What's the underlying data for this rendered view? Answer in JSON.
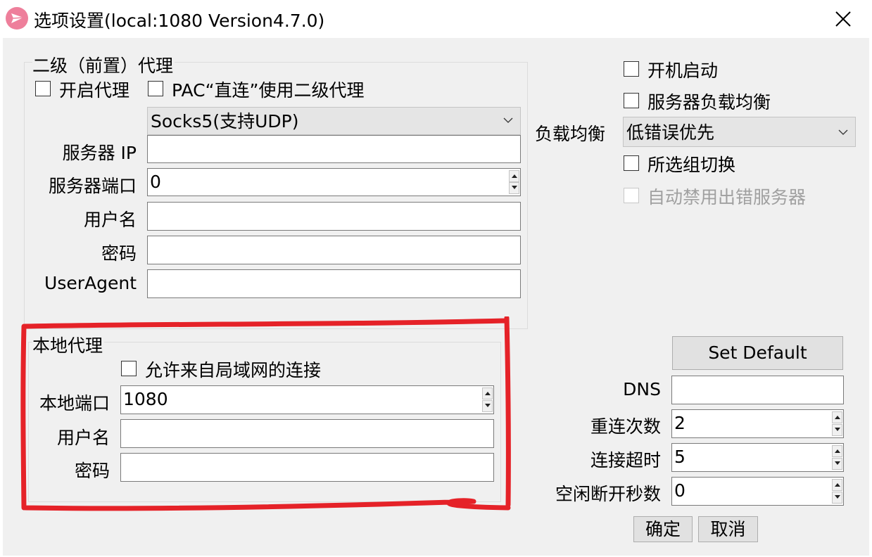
{
  "window": {
    "title": "选项设置(local:1080 Version4.7.0)"
  },
  "proxy_group": {
    "title": "二级（前置）代理",
    "enable_proxy_label": "开启代理",
    "pac_direct_label": "PAC“直连”使用二级代理",
    "proxy_type": "Socks5(支持UDP)",
    "server_ip_label": "服务器 IP",
    "server_ip_value": "",
    "server_port_label": "服务器端口",
    "server_port_value": "0",
    "username_label": "用户名",
    "username_value": "",
    "password_label": "密码",
    "password_value": "",
    "useragent_label": "UserAgent",
    "useragent_value": ""
  },
  "right_options": {
    "autostart_label": "开机启动",
    "load_balance_label": "服务器负载均衡",
    "balance_mode_label": "负载均衡",
    "balance_mode_value": "低错误优先",
    "group_switch_label": "所选组切换",
    "auto_disable_label": "自动禁用出错服务器"
  },
  "local_group": {
    "title": "本地代理",
    "allow_lan_label": "允许来自局域网的连接",
    "port_label": "本地端口",
    "port_value": "1080",
    "username_label": "用户名",
    "username_value": "",
    "password_label": "密码",
    "password_value": ""
  },
  "misc": {
    "set_default_label": "Set Default",
    "dns_label": "DNS",
    "dns_value": "",
    "reconnect_label": "重连次数",
    "reconnect_value": "2",
    "timeout_label": "连接超时",
    "timeout_value": "5",
    "idle_label": "空闲断开秒数",
    "idle_value": "0"
  },
  "buttons": {
    "ok_label": "确定",
    "cancel_label": "取消"
  },
  "colors": {
    "annotation_red": "#e52228",
    "app_icon": "#ee7f9b",
    "dialog_bg": "#f0f0f0"
  }
}
